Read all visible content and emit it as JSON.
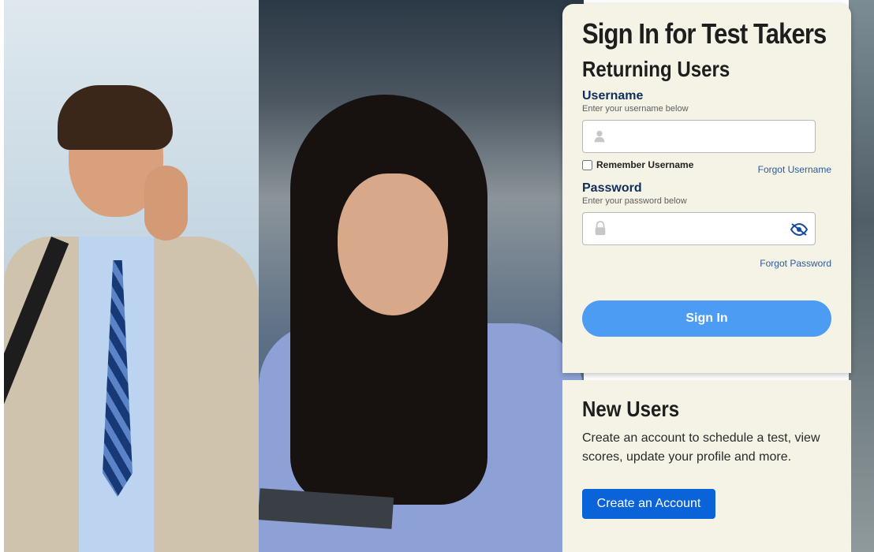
{
  "signin": {
    "title": "Sign In for Test Takers",
    "subtitle": "Returning Users",
    "username": {
      "label": "Username",
      "hint": "Enter your username below",
      "value": "",
      "placeholder": "",
      "icon": "user-icon"
    },
    "remember_label": "Remember Username",
    "forgot_username": "Forgot Username",
    "password": {
      "label": "Password",
      "hint": "Enter your password below",
      "value": "",
      "placeholder": "",
      "icon": "lock-icon",
      "toggle_icon": "eye-off-icon"
    },
    "forgot_password": "Forgot Password",
    "button_label": "Sign In",
    "colors": {
      "panel_bg": "#f4f3e6",
      "button": "#4c9cf3",
      "link": "#2f5a9a",
      "label": "#0f2f5a"
    }
  },
  "new_users": {
    "title": "New Users",
    "description": "Create an account to schedule a test, view scores, update your profile and more.",
    "button_label": "Create an Account",
    "button_color": "#0a63d8"
  }
}
